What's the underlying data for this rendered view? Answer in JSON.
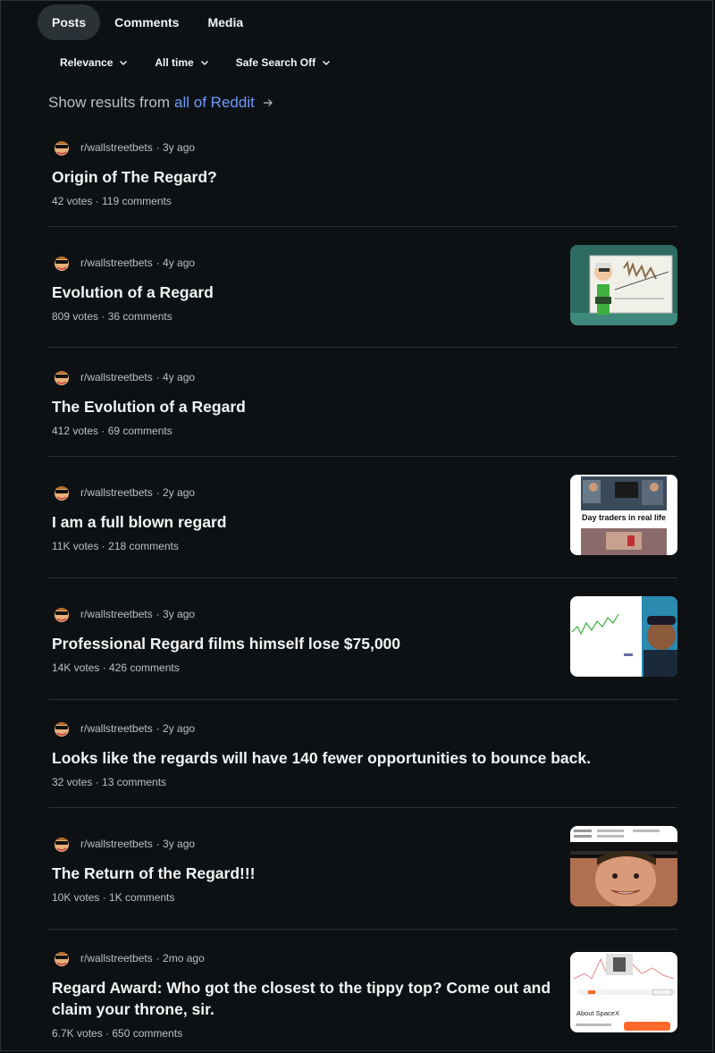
{
  "tabs": [
    "Posts",
    "Comments",
    "Media"
  ],
  "filters": [
    "Relevance",
    "All time",
    "Safe Search Off"
  ],
  "show_all": {
    "prefix": "Show results from",
    "link": "all of Reddit"
  },
  "posts": [
    {
      "subreddit": "r/wallstreetbets",
      "time": "3y ago",
      "title": "Origin of The Regard?",
      "stats": "42 votes · 119 comments"
    },
    {
      "subreddit": "r/wallstreetbets",
      "time": "4y ago",
      "title": "Evolution of a Regard",
      "stats": "809 votes · 36 comments"
    },
    {
      "subreddit": "r/wallstreetbets",
      "time": "4y ago",
      "title": "The Evolution of a Regard",
      "stats": "412 votes · 69 comments"
    },
    {
      "subreddit": "r/wallstreetbets",
      "time": "2y ago",
      "title": "I am a full blown regard",
      "stats": "11K votes · 218 comments",
      "thumb_text": "Day traders in real life"
    },
    {
      "subreddit": "r/wallstreetbets",
      "time": "3y ago",
      "title": "Professional Regard films himself lose $75,000",
      "stats": "14K votes · 426 comments"
    },
    {
      "subreddit": "r/wallstreetbets",
      "time": "2y ago",
      "title_pre": "Looks like the ",
      "title_bold": "regards",
      "title_post": " will have 140 fewer opportunities to bounce back.",
      "stats": "32 votes · 13 comments"
    },
    {
      "subreddit": "r/wallstreetbets",
      "time": "3y ago",
      "title": "The Return of the Regard!!!",
      "stats": "10K votes · 1K comments"
    },
    {
      "subreddit": "r/wallstreetbets",
      "time": "2mo ago",
      "title_line1": "Regard Award: Who got the closest to the tippy top? Come out and",
      "title_line2": "claim your throne, sir.",
      "stats": "6.7K votes · 650 comments",
      "thumb_text": "About SpaceX"
    }
  ],
  "colors": {
    "background": "#0e1113",
    "link": "#6b9bff",
    "muted": "#b7c1c7",
    "active_tab": "#2a3236"
  }
}
